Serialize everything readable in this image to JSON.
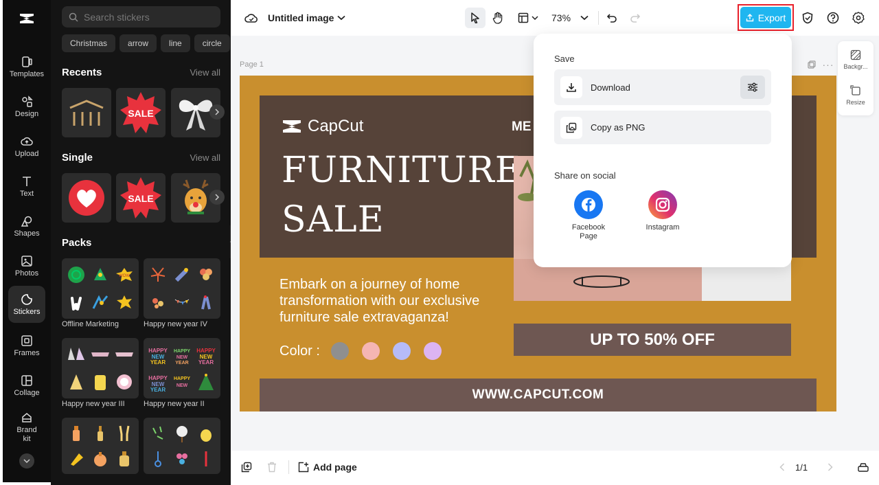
{
  "nav": {
    "items": [
      {
        "label": "Templates"
      },
      {
        "label": "Design"
      },
      {
        "label": "Upload"
      },
      {
        "label": "Text"
      },
      {
        "label": "Shapes"
      },
      {
        "label": "Photos"
      },
      {
        "label": "Stickers"
      },
      {
        "label": "Frames"
      },
      {
        "label": "Collage"
      },
      {
        "label": "Brand kit"
      }
    ],
    "active": "Stickers"
  },
  "stickers": {
    "search_placeholder": "Search stickers",
    "chips": [
      "Christmas",
      "arrow",
      "line",
      "circle"
    ],
    "recents_title": "Recents",
    "single_title": "Single",
    "packs_title": "Packs",
    "view_all": "View all",
    "sale_text": "SALE",
    "packs": [
      {
        "label": "Offline Marketing"
      },
      {
        "label": "Happy new year IV"
      },
      {
        "label": "Happy new year III"
      },
      {
        "label": "Happy new year II"
      }
    ]
  },
  "topbar": {
    "doc_title": "Untitled image",
    "zoom": "73%",
    "export_label": "Export"
  },
  "canvas": {
    "page_label": "Page 1",
    "brand": "CapCut",
    "headline_1": "FURNITURE",
    "headline_2": "SALE",
    "partial_text": "ME",
    "body": "Embark on a journey of home transformation with our exclusive furniture sale extravaganza!",
    "color_label": "Color :",
    "swatches": [
      "#8f8f8f",
      "#f5b5b3",
      "#b6bbf7",
      "#dcb4f2"
    ],
    "offer": "UP TO 50% OFF",
    "url": "WWW.CAPCUT.COM"
  },
  "export_menu": {
    "save_title": "Save",
    "download": "Download",
    "copy_png": "Copy as PNG",
    "share_title": "Share on social",
    "facebook": "Facebook Page",
    "instagram": "Instagram"
  },
  "side_tools": {
    "background": "Backgr...",
    "resize": "Resize"
  },
  "bottombar": {
    "add_page": "Add page",
    "page_count": "1/1"
  },
  "colors": {
    "accent": "#1fb6f0",
    "export_highlight": "#e8202a",
    "design_bg": "#c98f2e",
    "design_dark": "#564339"
  }
}
